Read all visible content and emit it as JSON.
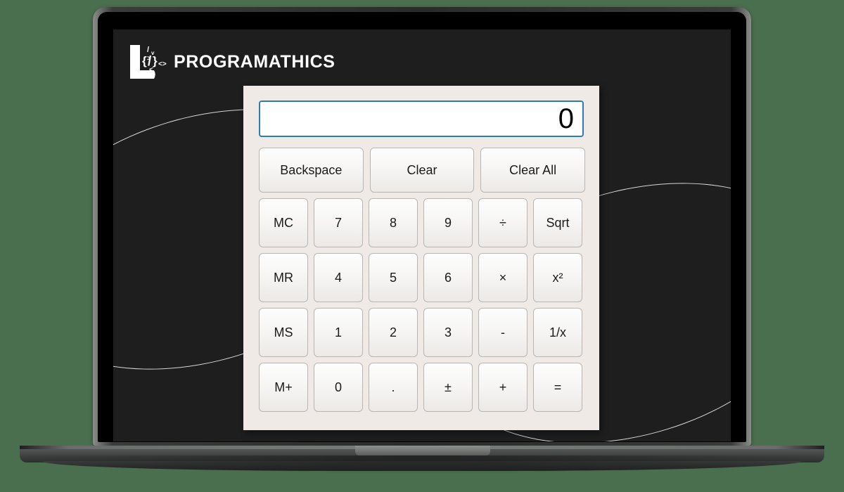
{
  "brand": {
    "name": "PROGRAMATHICS",
    "mark_icon": "programathics-p-code-logo"
  },
  "calculator": {
    "display": {
      "value": "0",
      "placeholder": "0"
    },
    "top_row": [
      {
        "label": "Backspace",
        "name": "backspace"
      },
      {
        "label": "Clear",
        "name": "clear"
      },
      {
        "label": "Clear All",
        "name": "clear-all"
      }
    ],
    "keys": [
      [
        {
          "label": "MC",
          "name": "memory-clear"
        },
        {
          "label": "7",
          "name": "digit-7"
        },
        {
          "label": "8",
          "name": "digit-8"
        },
        {
          "label": "9",
          "name": "digit-9"
        },
        {
          "label": "÷",
          "name": "divide"
        },
        {
          "label": "Sqrt",
          "name": "square-root"
        }
      ],
      [
        {
          "label": "MR",
          "name": "memory-recall"
        },
        {
          "label": "4",
          "name": "digit-4"
        },
        {
          "label": "5",
          "name": "digit-5"
        },
        {
          "label": "6",
          "name": "digit-6"
        },
        {
          "label": "×",
          "name": "multiply"
        },
        {
          "label": "x²",
          "name": "square"
        }
      ],
      [
        {
          "label": "MS",
          "name": "memory-store"
        },
        {
          "label": "1",
          "name": "digit-1"
        },
        {
          "label": "2",
          "name": "digit-2"
        },
        {
          "label": "3",
          "name": "digit-3"
        },
        {
          "label": "-",
          "name": "subtract"
        },
        {
          "label": "1/x",
          "name": "reciprocal"
        }
      ],
      [
        {
          "label": "M+",
          "name": "memory-add"
        },
        {
          "label": "0",
          "name": "digit-0"
        },
        {
          "label": ".",
          "name": "decimal-point"
        },
        {
          "label": "±",
          "name": "plus-minus"
        },
        {
          "label": "+",
          "name": "add"
        },
        {
          "label": "=",
          "name": "equals"
        }
      ]
    ]
  },
  "colors": {
    "background_green": "#4a6f4e",
    "screen_dark": "#1e1e1e",
    "panel_beige": "#efeae5",
    "display_border_blue": "#2e7cb0",
    "button_face": "#f5f3f1",
    "decoration_stroke": "#d8d8d8"
  }
}
